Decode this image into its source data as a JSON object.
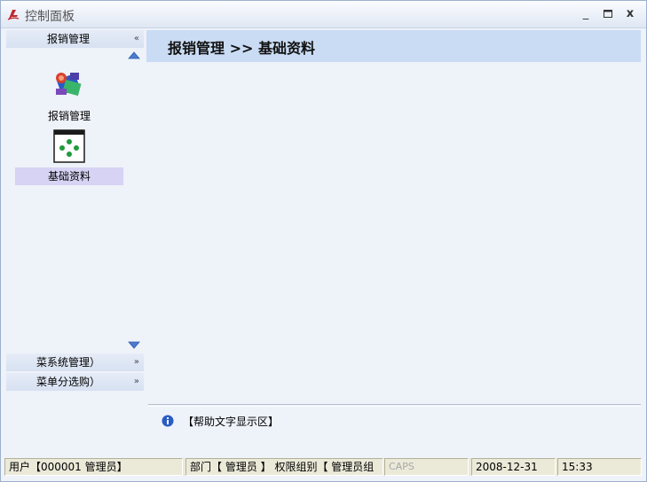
{
  "window": {
    "title": "控制面板"
  },
  "sidebar": {
    "groups": [
      {
        "label": "报销管理",
        "expanded": true,
        "chevron": "«"
      },
      {
        "label": "菜系统管理）",
        "expanded": false,
        "chevron": "»"
      },
      {
        "label": "菜单分选购）",
        "expanded": false,
        "chevron": "»"
      }
    ],
    "items": [
      {
        "label": "报销管理",
        "icon": "reimbursement-icon",
        "selected": false
      },
      {
        "label": "基础资料",
        "icon": "basic-data-icon",
        "selected": true
      }
    ]
  },
  "main": {
    "breadcrumb": "报销管理 >> 基础资料"
  },
  "help": {
    "text": "【帮助文字显示区】"
  },
  "status": {
    "user": "用户【000001 管理员】",
    "dept_perm": "部门【 管理员 】 权限组别【 管理员组",
    "caps": "CAPS",
    "date": "2008-12-31",
    "time": "15:33"
  },
  "colors": {
    "header_bg": "#c9dcf3",
    "selected_item_bg": "#d6d3f4",
    "window_bg": "#eef2f9"
  }
}
